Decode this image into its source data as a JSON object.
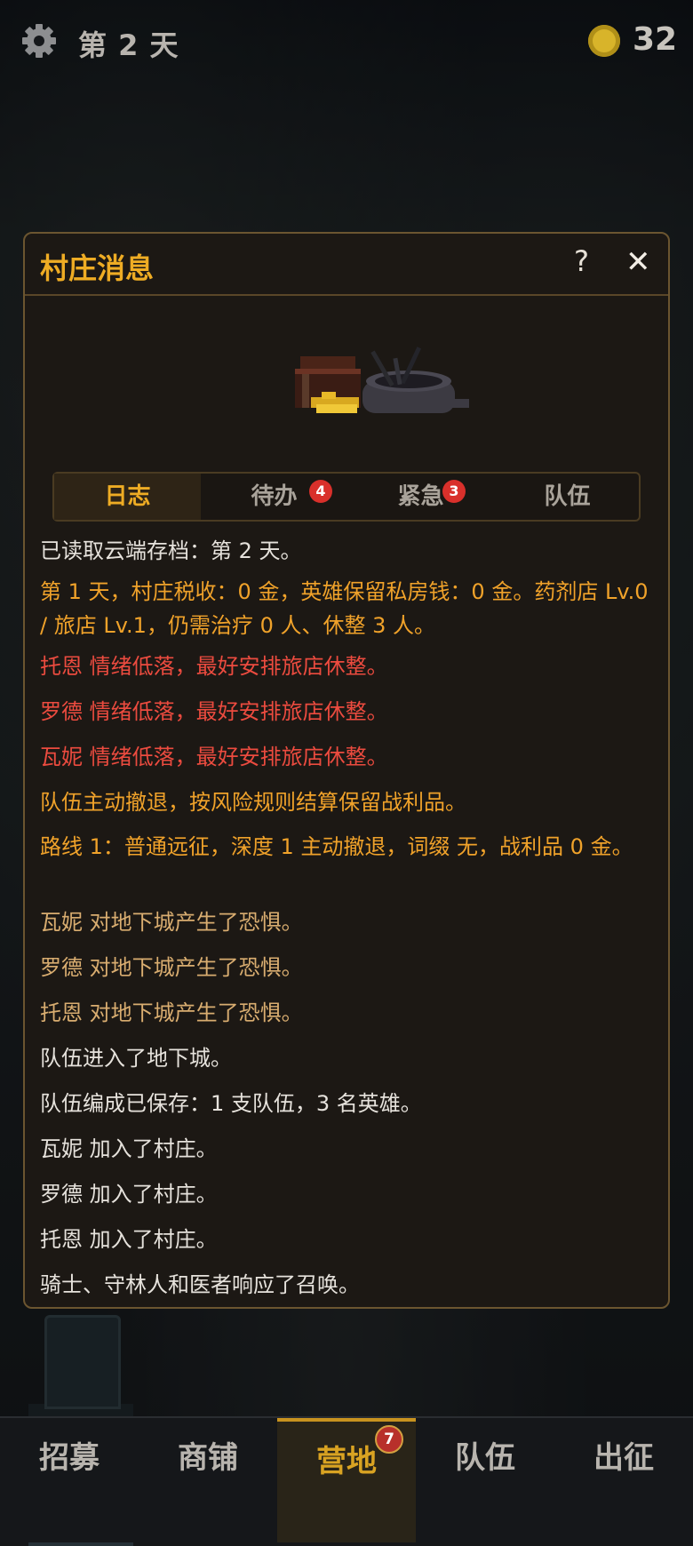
{
  "topbar": {
    "day": "第 2 天",
    "coins": "32"
  },
  "modal": {
    "title": "村庄消息",
    "help": "?",
    "close": "✕",
    "tabs": [
      {
        "label": "日志"
      },
      {
        "label": "待办",
        "badge": "4"
      },
      {
        "label": "紧急",
        "badge": "3"
      },
      {
        "label": "队伍"
      }
    ],
    "log": [
      {
        "text": "已读取云端存档：第 2 天。",
        "color": "#e6e2dc"
      },
      {
        "text": "第 1 天，村庄税收：0 金，英雄保留私房钱：0 金。药剂店 Lv.0 / 旅店 Lv.1，仍需治疗 0 人、休整 3 人。",
        "color": "#f0a22a"
      },
      {
        "text": " 托恩 情绪低落，最好安排旅店休整。",
        "color": "#ec4b3f"
      },
      {
        "text": "罗德 情绪低落，最好安排旅店休整。",
        "color": "#ec4b3f"
      },
      {
        "text": "瓦妮 情绪低落，最好安排旅店休整。",
        "color": "#ec4b3f"
      },
      {
        "text": "队伍主动撤退，按风险规则结算保留战利品。",
        "color": "#f0a22a"
      },
      {
        "text": " 路线 1：普通远征，深度 1 主动撤退，词缀 无，战利品 0 金。",
        "color": "#f0a22a"
      },
      {
        "text": "瓦妮 对地下城产生了恐惧。",
        "color": "#d9ad70"
      },
      {
        "text": "罗德 对地下城产生了恐惧。",
        "color": "#d9ad70"
      },
      {
        "text": " 托恩 对地下城产生了恐惧。",
        "color": "#d9ad70"
      },
      {
        "text": "队伍进入了地下城。",
        "color": "#e6e2dc"
      },
      {
        "text": "队伍编成已保存：1 支队伍，3 名英雄。",
        "color": "#e6e2dc"
      },
      {
        "text": "瓦妮 加入了村庄。",
        "color": "#e6e2dc"
      },
      {
        "text": "罗德 加入了村庄。",
        "color": "#e6e2dc"
      },
      {
        "text": " 托恩 加入了村庄。",
        "color": "#e6e2dc"
      },
      {
        "text": " 骑士、守林人和医者响应了召唤。",
        "color": "#e6e2dc"
      }
    ]
  },
  "nav": [
    {
      "label": "招募"
    },
    {
      "label": "商铺"
    },
    {
      "label": "营地",
      "badge": "7"
    },
    {
      "label": "队伍"
    },
    {
      "label": "出征"
    }
  ],
  "icons": {
    "settings": "gear-icon",
    "coin": "coin-icon",
    "art": "treasure-chest-and-cauldron-icon"
  }
}
